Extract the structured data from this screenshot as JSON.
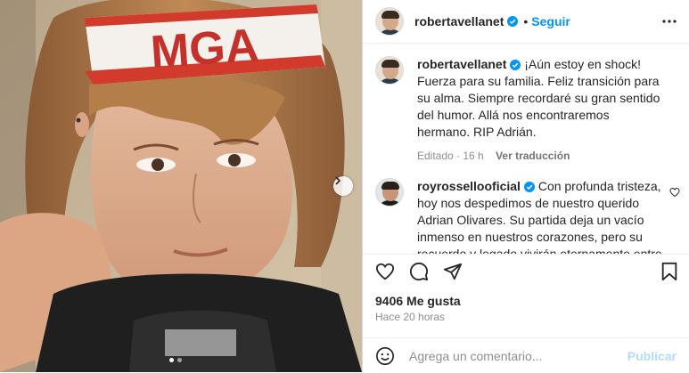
{
  "header": {
    "username": "robertavellanet",
    "follow_label": "Seguir",
    "separator": "•"
  },
  "media": {
    "headband_text": "MGA",
    "slide_count": 2,
    "active_slide": 1
  },
  "comments": [
    {
      "username": "robertavellanet",
      "verified": true,
      "text": "¡Aún estoy en shock! Fuerza para su familia. Feliz transición para su alma. Siempre recordaré su gran sentido del humor. Allá nos encontraremos hermano. RIP Adrián.",
      "meta_time": "Editado · 16 h",
      "translation_label": "Ver traducción"
    },
    {
      "username": "royrossellooficial",
      "verified": true,
      "text": "Con profunda tristeza, hoy nos despedimos de nuestro querido Adrian Olivares. Su partida deja un vacío inmenso en nuestros corazones, pero su recuerdo y legado vivirán eternamente entre nosotros. Que descanse en paz y que Dios, en su infinita misericordia, brinde consuelo y"
    }
  ],
  "likes": {
    "count_label": "9406 Me gusta"
  },
  "time": {
    "label": "Hace 20 horas"
  },
  "add_comment": {
    "placeholder": "Agrega un comentario...",
    "publish_label": "Publicar"
  },
  "colors": {
    "accent": "#0095f6",
    "verified": "#0095f6",
    "muted": "#8e8e8e",
    "publish_disabled": "#b3dbff"
  },
  "icons": [
    "verified-badge-icon",
    "more-options-icon",
    "heart-icon",
    "comment-icon",
    "share-icon",
    "bookmark-icon",
    "emoji-icon",
    "chevron-right-icon"
  ]
}
